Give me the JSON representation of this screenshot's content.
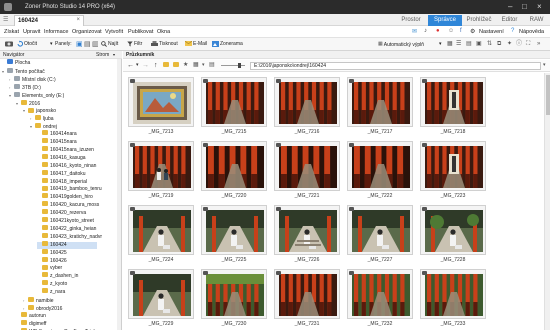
{
  "titlebar": {
    "title": "Zoner Photo Studio 14 PRO (x64)"
  },
  "tab": {
    "label": "160424",
    "close": "×"
  },
  "modes": [
    {
      "label": "Prostor",
      "active": false
    },
    {
      "label": "Správce",
      "active": true
    },
    {
      "label": "Prohlížeč",
      "active": false
    },
    {
      "label": "Editor",
      "active": false
    },
    {
      "label": "RAW",
      "active": false
    }
  ],
  "menu": [
    "Získat",
    "Upravit",
    "Informace",
    "Organizovat",
    "Vytvořit",
    "Publikovat",
    "Okna"
  ],
  "menu_right": {
    "settings": "Nastavení",
    "help": "Nápověda"
  },
  "toolbar": {
    "back": "Otočit",
    "panels": "Panely:",
    "find": "Najít",
    "filter": "Filtr",
    "print": "Tisknout",
    "email": "E-Mail",
    "zoner": "Zonerama",
    "autofill": "Automatický výplň"
  },
  "sidebar": {
    "header": "Navigátor",
    "header_right": "Strom",
    "tree": [
      {
        "label": "Plocha",
        "depth": 0,
        "icon": "blue",
        "arrow": ""
      },
      {
        "label": "Tento počítač",
        "depth": 0,
        "icon": "gray",
        "arrow": "▾"
      },
      {
        "label": "Místní disk (C:)",
        "depth": 1,
        "icon": "gray",
        "arrow": "›"
      },
      {
        "label": "3TB (D:)",
        "depth": 1,
        "icon": "gray",
        "arrow": "›"
      },
      {
        "label": "Elements_only (E:)",
        "depth": 1,
        "icon": "gray",
        "arrow": "▾"
      },
      {
        "label": "2016",
        "depth": 2,
        "icon": "yellow",
        "arrow": "▾"
      },
      {
        "label": "japonsko",
        "depth": 3,
        "icon": "yellow",
        "arrow": "▾"
      },
      {
        "label": "ljuba",
        "depth": 4,
        "icon": "yellow",
        "arrow": "›"
      },
      {
        "label": "ondrej",
        "depth": 4,
        "icon": "yellow",
        "arrow": "▾"
      },
      {
        "label": "160414nara",
        "depth": 5,
        "icon": "yellow",
        "arrow": ""
      },
      {
        "label": "160415nara",
        "depth": 5,
        "icon": "yellow",
        "arrow": ""
      },
      {
        "label": "160415nara_izuzen",
        "depth": 5,
        "icon": "yellow",
        "arrow": ""
      },
      {
        "label": "160416_kasuga",
        "depth": 5,
        "icon": "yellow",
        "arrow": ""
      },
      {
        "label": "160416_kyoto_ninan",
        "depth": 5,
        "icon": "yellow",
        "arrow": ""
      },
      {
        "label": "160417_daitoku",
        "depth": 5,
        "icon": "yellow",
        "arrow": ""
      },
      {
        "label": "160418_imperial",
        "depth": 5,
        "icon": "yellow",
        "arrow": ""
      },
      {
        "label": "160419_bamboo_tenru",
        "depth": 5,
        "icon": "yellow",
        "arrow": ""
      },
      {
        "label": "160419golden_hiro",
        "depth": 5,
        "icon": "yellow",
        "arrow": ""
      },
      {
        "label": "160420_kacura_moss",
        "depth": 5,
        "icon": "yellow",
        "arrow": ""
      },
      {
        "label": "160420_rezerva",
        "depth": 5,
        "icon": "yellow",
        "arrow": ""
      },
      {
        "label": "160421kyoto_street",
        "depth": 5,
        "icon": "yellow",
        "arrow": ""
      },
      {
        "label": "160422_ginka_heian",
        "depth": 5,
        "icon": "yellow",
        "arrow": ""
      },
      {
        "label": "160423_kratichy_nadvr",
        "depth": 5,
        "icon": "yellow",
        "arrow": ""
      },
      {
        "label": "160424",
        "depth": 5,
        "icon": "yellow",
        "arrow": "",
        "selected": true
      },
      {
        "label": "160425",
        "depth": 5,
        "icon": "yellow",
        "arrow": ""
      },
      {
        "label": "160426",
        "depth": 5,
        "icon": "yellow",
        "arrow": ""
      },
      {
        "label": "vyber",
        "depth": 5,
        "icon": "yellow",
        "arrow": ""
      },
      {
        "label": "z_dashen_in",
        "depth": 5,
        "icon": "yellow",
        "arrow": ""
      },
      {
        "label": "z_kyoto",
        "depth": 5,
        "icon": "yellow",
        "arrow": ""
      },
      {
        "label": "z_nara",
        "depth": 5,
        "icon": "yellow",
        "arrow": ""
      },
      {
        "label": "namibie",
        "depth": 3,
        "icon": "yellow",
        "arrow": "›"
      },
      {
        "label": "obrody2016",
        "depth": 3,
        "icon": "yellow",
        "arrow": "›"
      },
      {
        "label": "autorun",
        "depth": 2,
        "icon": "yellow",
        "arrow": ""
      },
      {
        "label": "digimeff",
        "depth": 2,
        "icon": "yellow",
        "arrow": ""
      },
      {
        "label": "WD Smartware Pro Free Trial",
        "depth": 2,
        "icon": "yellow",
        "arrow": ""
      }
    ]
  },
  "main": {
    "header": "Průzkumník",
    "path": "E:\\2016\\japonsko\\ondrej\\160424",
    "thumbs": [
      {
        "caption": "_MG_7213",
        "scene": "shrine"
      },
      {
        "caption": "_MG_7215",
        "scene": "torii"
      },
      {
        "caption": "_MG_7216",
        "scene": "torii"
      },
      {
        "caption": "_MG_7217",
        "scene": "torii"
      },
      {
        "caption": "_MG_7218",
        "scene": "torii-sign"
      },
      {
        "caption": "_MG_7219",
        "scene": "torii-people"
      },
      {
        "caption": "_MG_7220",
        "scene": "torii-dark"
      },
      {
        "caption": "_MG_7221",
        "scene": "torii-dark"
      },
      {
        "caption": "_MG_7222",
        "scene": "torii-dark"
      },
      {
        "caption": "_MG_7223",
        "scene": "torii-sign"
      },
      {
        "caption": "_MG_7224",
        "scene": "people-path"
      },
      {
        "caption": "_MG_7225",
        "scene": "people-path"
      },
      {
        "caption": "_MG_7226",
        "scene": "people-stairs"
      },
      {
        "caption": "_MG_7227",
        "scene": "people-path"
      },
      {
        "caption": "_MG_7228",
        "scene": "people-garden"
      },
      {
        "caption": "_MG_7229",
        "scene": "people-path"
      },
      {
        "caption": "_MG_7230",
        "scene": "torii-tree"
      },
      {
        "caption": "_MG_7231",
        "scene": "torii-red"
      },
      {
        "caption": "_MG_7232",
        "scene": "torii-green"
      },
      {
        "caption": "_MG_7233",
        "scene": "torii-green"
      }
    ]
  },
  "colors": {
    "accent": "#2f86d8",
    "folder": "#e8b93a",
    "torii": "#c8401a"
  }
}
